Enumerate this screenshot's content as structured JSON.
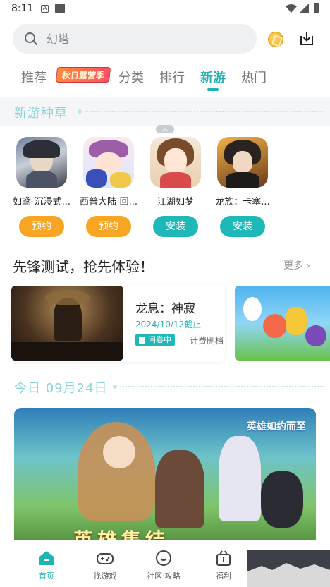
{
  "status_bar": {
    "time": "8:11",
    "sim_letter": "A"
  },
  "search": {
    "placeholder": "幻塔"
  },
  "tabs": [
    {
      "label": "推荐"
    },
    {
      "label": "秋日露营季",
      "badge": true
    },
    {
      "label": "分类"
    },
    {
      "label": "排行"
    },
    {
      "label": "新游",
      "active": true
    },
    {
      "label": "热门"
    }
  ],
  "new_games_section": {
    "title": "新游种草"
  },
  "games": [
    {
      "name": "如鸢-沉浸式...",
      "action": "预约",
      "action_color": "#f7a522"
    },
    {
      "name": "西普大陆-回...",
      "action": "预约",
      "action_color": "#f7a522"
    },
    {
      "name": "江湖如梦",
      "action": "安装",
      "action_color": "#1fb8b8"
    },
    {
      "name": "龙族：卡塞...",
      "action": "安装",
      "action_color": "#1fb8b8"
    }
  ],
  "pioneer": {
    "title": "先锋测试，抢先体验！",
    "more": "更多",
    "card": {
      "name": "龙息：神寂",
      "date": "2024/10/12截止",
      "tag": "问卷中",
      "tag2": "计费删档"
    }
  },
  "today": {
    "label": "今日 09月24日"
  },
  "banner": {
    "logo_text": "英雄如约而至",
    "slogan": "英雄集结"
  },
  "bottom_nav": [
    {
      "label": "首页",
      "active": true
    },
    {
      "label": "找游戏"
    },
    {
      "label": "社区·攻略"
    },
    {
      "label": "福利"
    }
  ],
  "colors": {
    "accent": "#1eb4b4",
    "reserve": "#f7a522",
    "install": "#1fb8b8"
  }
}
